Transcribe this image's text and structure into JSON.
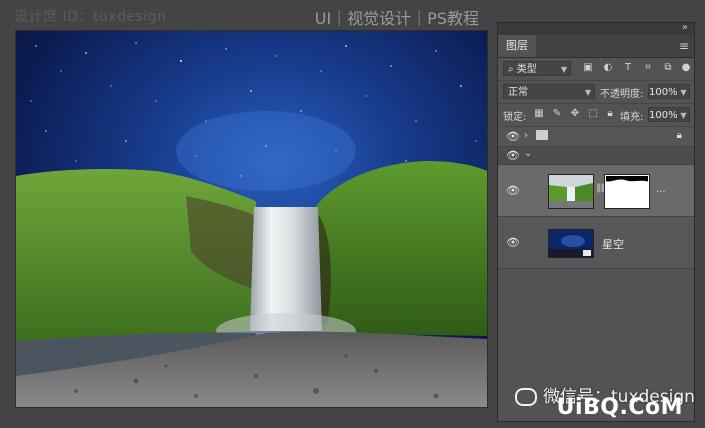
{
  "watermarks": {
    "top_left": "设计庶 ID：tuxdesign",
    "top_right": "UI｜视觉设计｜PS教程",
    "bottom_wechat": "微信号：tuxdesign",
    "bottom_site": "UiBQ.CoM"
  },
  "panel": {
    "collapse_icon": "»",
    "tab_label": "图层",
    "menu_icon": "≡",
    "filter": {
      "search_glyph": "⌕",
      "kind_label": "类型"
    },
    "blend": {
      "mode": "正常",
      "opacity_label": "不透明度:",
      "opacity_value": "100%"
    },
    "lock": {
      "label": "锁定:",
      "fill_label": "填充:",
      "fill_value": "100%"
    },
    "layers": [
      {
        "name": "",
        "type": "group"
      },
      {
        "name": "",
        "type": "image-with-mask"
      },
      {
        "name": "星空",
        "type": "image"
      }
    ],
    "more_glyph": "..."
  },
  "colors": {
    "panel_bg": "#535353",
    "app_bg": "#444444",
    "selected_layer": "#6a6a6a"
  }
}
